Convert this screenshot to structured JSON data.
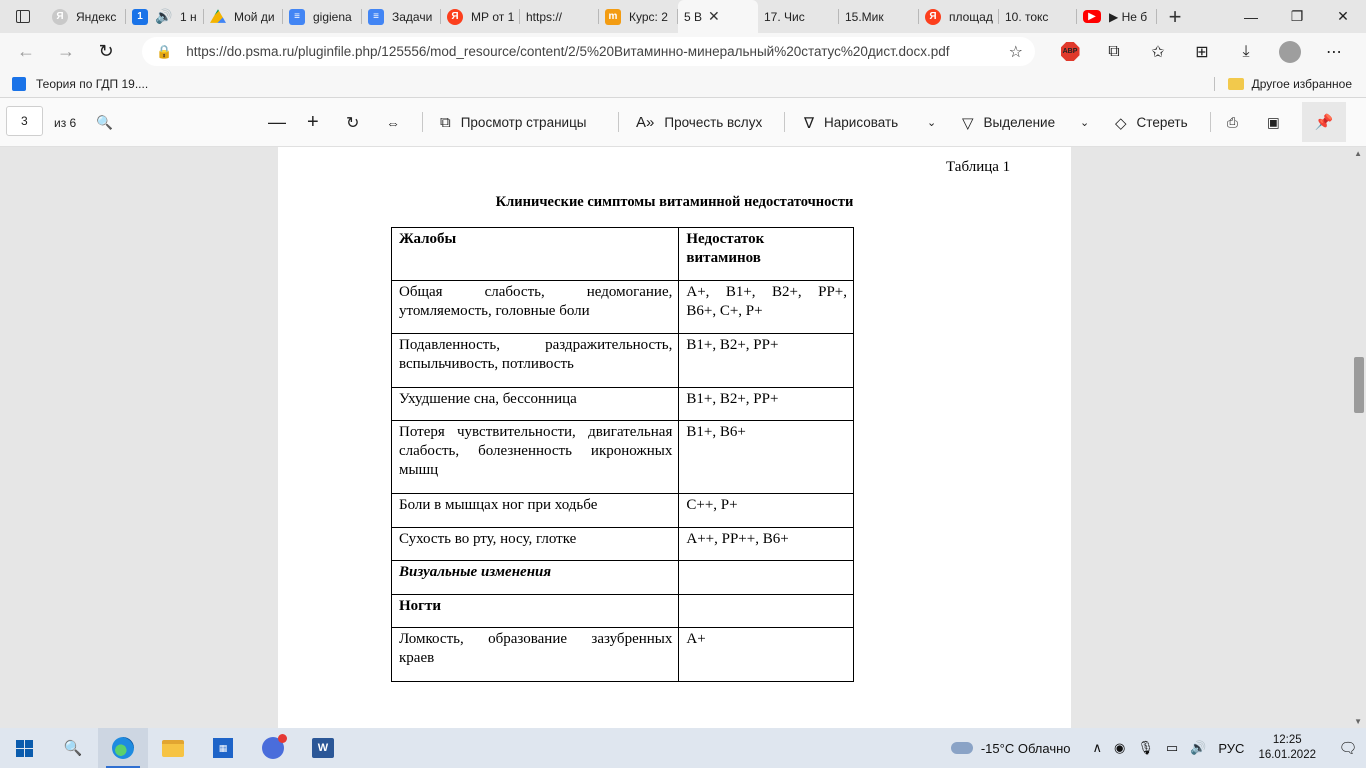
{
  "tabs": [
    {
      "label": "Яндекс",
      "icon": "yandex-gray-icon"
    },
    {
      "label": "1 н",
      "icon": "speaker-icon"
    },
    {
      "label": "Мой ди",
      "icon": "google-drive-icon"
    },
    {
      "label": "gigiena",
      "icon": "google-docs-icon"
    },
    {
      "label": "Задачи",
      "icon": "google-docs-icon"
    },
    {
      "label": "МР от 1",
      "icon": "yandex-icon"
    },
    {
      "label": "https://",
      "icon": "page-icon"
    },
    {
      "label": "Курс: 2",
      "icon": "moodle-icon"
    },
    {
      "label": "5 В",
      "icon": "page-icon",
      "active": true
    },
    {
      "label": "17. Чис",
      "icon": "page-icon"
    },
    {
      "label": "15.Мик",
      "icon": "page-icon"
    },
    {
      "label": "площад",
      "icon": "yandex-icon"
    },
    {
      "label": "10. токс",
      "icon": "page-icon"
    },
    {
      "label": "▶ Не б",
      "icon": "youtube-icon"
    }
  ],
  "tab_prefix_one": "1",
  "address": {
    "url": "https://do.psma.ru/pluginfile.php/125556/mod_resource/content/2/5%20Витаминно-минеральный%20статус%20дист.docx.pdf"
  },
  "favorites": {
    "item": "Теория по ГДП 19....",
    "other": "Другое избранное"
  },
  "pdf_toolbar": {
    "page_number": "3",
    "page_total": "из 6",
    "page_view": "Просмотр страницы",
    "read_aloud": "Прочесть вслух",
    "draw": "Нарисовать",
    "highlight": "Выделение",
    "erase": "Стереть"
  },
  "document": {
    "table_label": "Таблица 1",
    "table_title": "Клинические симптомы витаминной недостаточности",
    "header": {
      "col1": "Жалобы",
      "col2_line1": "Недостаток",
      "col2_line2": "витаминов"
    },
    "rows": [
      {
        "c1a": "Общая слабость, недомогание,",
        "c1b": "утомляемость, головные боли",
        "c2a": "А+, В1+, В2+, РР+,",
        "c2b": "В6+, С+, Р+"
      },
      {
        "c1a": "Подавленность, раздражительность,",
        "c1b": "вспыльчивость, потливость",
        "c2a": "В1+, В2+, РР+"
      },
      {
        "c1a": "Ухудшение сна, бессонница",
        "c2a": "В1+, В2+, РР+"
      },
      {
        "c1a": "Потеря чувствительности, двигательная",
        "c1b": "слабость, болезненность икроножных",
        "c1c": "мышц",
        "c2a": "В1+, В6+"
      },
      {
        "c1a": "Боли в мышцах ног при ходьбе",
        "c2a": "С++, Р+"
      },
      {
        "c1a": "Сухость во рту, носу, глотке",
        "c2a": "А++, РР++, В6+"
      },
      {
        "c1a": "Визуальные изменения",
        "style": "bold-italic"
      },
      {
        "c1a": "Ногти",
        "style": "bold"
      },
      {
        "c1a": "Ломкость, образование зазубренных",
        "c1b": "краев",
        "c2a": "А+"
      }
    ]
  },
  "taskbar": {
    "weather": "-15°C  Облачно",
    "lang": "РУС",
    "time": "12:25",
    "date": "16.01.2022"
  }
}
